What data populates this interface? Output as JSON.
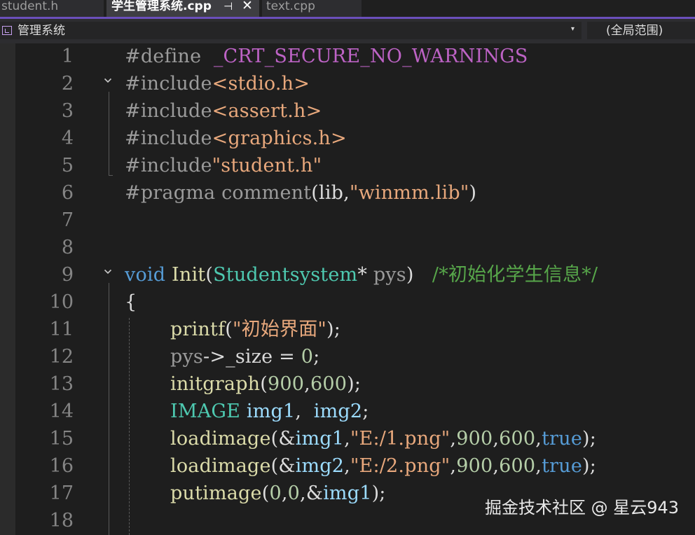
{
  "tabs": [
    {
      "label": "student.h",
      "active": false
    },
    {
      "label": "学生管理系统.cpp",
      "active": true
    },
    {
      "label": "text.cpp",
      "active": false
    }
  ],
  "tab_controls": {
    "pin": "⊣",
    "close": "✕"
  },
  "navigation": {
    "scope_label": "管理系统",
    "dropdown_arrow": "▾",
    "global_scope": "(全局范围)"
  },
  "code_lines": [
    {
      "n": "1",
      "fold": "",
      "parts": [
        {
          "t": "#define  ",
          "c": "#9b9b9b"
        },
        {
          "t": "_CRT_SECURE_NO_WARNINGS",
          "c": "#bd63c5"
        }
      ]
    },
    {
      "n": "2",
      "fold": "v",
      "parts": [
        {
          "t": "#include",
          "c": "#9b9b9b"
        },
        {
          "t": "<stdio.h>",
          "c": "#e8a87c"
        }
      ]
    },
    {
      "n": "3",
      "fold": "",
      "parts": [
        {
          "t": "#include",
          "c": "#9b9b9b"
        },
        {
          "t": "<assert.h>",
          "c": "#e8a87c"
        }
      ]
    },
    {
      "n": "4",
      "fold": "",
      "parts": [
        {
          "t": "#include",
          "c": "#9b9b9b"
        },
        {
          "t": "<graphics.h>",
          "c": "#e8a87c"
        }
      ]
    },
    {
      "n": "5",
      "fold": "",
      "parts": [
        {
          "t": "#include",
          "c": "#9b9b9b"
        },
        {
          "t": "\"student.h\"",
          "c": "#e8a87c"
        }
      ]
    },
    {
      "n": "6",
      "fold": "",
      "parts": [
        {
          "t": "#pragma comment",
          "c": "#9b9b9b"
        },
        {
          "t": "(lib,",
          "c": "#dcdcdc"
        },
        {
          "t": "\"winmm.lib\"",
          "c": "#e8a87c"
        },
        {
          "t": ")",
          "c": "#dcdcdc"
        }
      ]
    },
    {
      "n": "7",
      "fold": "",
      "parts": []
    },
    {
      "n": "8",
      "fold": "",
      "parts": []
    },
    {
      "n": "9",
      "fold": "v",
      "parts": [
        {
          "t": "void ",
          "c": "#569cd6"
        },
        {
          "t": "Init",
          "c": "#dcdcaa"
        },
        {
          "t": "(",
          "c": "#dcdcdc"
        },
        {
          "t": "Studentsystem",
          "c": "#4ec9b0"
        },
        {
          "t": "* ",
          "c": "#dcdcdc"
        },
        {
          "t": "pys",
          "c": "#9a9a9a"
        },
        {
          "t": ")   ",
          "c": "#dcdcdc"
        },
        {
          "t": "/*初始化学生信息*/",
          "c": "#57a64a"
        }
      ]
    },
    {
      "n": "10",
      "fold": "",
      "parts": [
        {
          "t": "{",
          "c": "#dcdcdc"
        }
      ]
    },
    {
      "n": "11",
      "fold": "",
      "indent": true,
      "parts": [
        {
          "t": "printf",
          "c": "#dcdcaa"
        },
        {
          "t": "(",
          "c": "#dcdcdc"
        },
        {
          "t": "\"初始界面\"",
          "c": "#e8a87c"
        },
        {
          "t": ");",
          "c": "#dcdcdc"
        }
      ]
    },
    {
      "n": "12",
      "fold": "",
      "indent": true,
      "parts": [
        {
          "t": "pys",
          "c": "#9a9a9a"
        },
        {
          "t": "->",
          "c": "#dcdcdc"
        },
        {
          "t": "_size",
          "c": "#dadada"
        },
        {
          "t": " = ",
          "c": "#dcdcdc"
        },
        {
          "t": "0",
          "c": "#b5cea8"
        },
        {
          "t": ";",
          "c": "#dcdcdc"
        }
      ]
    },
    {
      "n": "13",
      "fold": "",
      "indent": true,
      "parts": [
        {
          "t": "initgraph",
          "c": "#dcdcaa"
        },
        {
          "t": "(",
          "c": "#dcdcdc"
        },
        {
          "t": "900",
          "c": "#b5cea8"
        },
        {
          "t": ",",
          "c": "#dcdcdc"
        },
        {
          "t": "600",
          "c": "#b5cea8"
        },
        {
          "t": ");",
          "c": "#dcdcdc"
        }
      ]
    },
    {
      "n": "14",
      "fold": "",
      "indent": true,
      "parts": [
        {
          "t": "IMAGE ",
          "c": "#4ec9b0"
        },
        {
          "t": "img1",
          "c": "#9cdcfe"
        },
        {
          "t": ",  ",
          "c": "#dcdcdc"
        },
        {
          "t": "img2",
          "c": "#9cdcfe"
        },
        {
          "t": ";",
          "c": "#dcdcdc"
        }
      ]
    },
    {
      "n": "15",
      "fold": "",
      "indent": true,
      "parts": [
        {
          "t": "loadimage",
          "c": "#dcdcaa"
        },
        {
          "t": "(&",
          "c": "#dcdcdc"
        },
        {
          "t": "img1",
          "c": "#9cdcfe"
        },
        {
          "t": ",",
          "c": "#dcdcdc"
        },
        {
          "t": "\"E:/1.png\"",
          "c": "#e8a87c"
        },
        {
          "t": ",",
          "c": "#dcdcdc"
        },
        {
          "t": "900",
          "c": "#b5cea8"
        },
        {
          "t": ",",
          "c": "#dcdcdc"
        },
        {
          "t": "600",
          "c": "#b5cea8"
        },
        {
          "t": ",",
          "c": "#dcdcdc"
        },
        {
          "t": "true",
          "c": "#569cd6"
        },
        {
          "t": ");",
          "c": "#dcdcdc"
        }
      ]
    },
    {
      "n": "16",
      "fold": "",
      "indent": true,
      "parts": [
        {
          "t": "loadimage",
          "c": "#dcdcaa"
        },
        {
          "t": "(&",
          "c": "#dcdcdc"
        },
        {
          "t": "img2",
          "c": "#9cdcfe"
        },
        {
          "t": ",",
          "c": "#dcdcdc"
        },
        {
          "t": "\"E:/2.png\"",
          "c": "#e8a87c"
        },
        {
          "t": ",",
          "c": "#dcdcdc"
        },
        {
          "t": "900",
          "c": "#b5cea8"
        },
        {
          "t": ",",
          "c": "#dcdcdc"
        },
        {
          "t": "600",
          "c": "#b5cea8"
        },
        {
          "t": ",",
          "c": "#dcdcdc"
        },
        {
          "t": "true",
          "c": "#569cd6"
        },
        {
          "t": ");",
          "c": "#dcdcdc"
        }
      ]
    },
    {
      "n": "17",
      "fold": "",
      "indent": true,
      "parts": [
        {
          "t": "putimage",
          "c": "#dcdcaa"
        },
        {
          "t": "(",
          "c": "#dcdcdc"
        },
        {
          "t": "0",
          "c": "#b5cea8"
        },
        {
          "t": ",",
          "c": "#dcdcdc"
        },
        {
          "t": "0",
          "c": "#b5cea8"
        },
        {
          "t": ",&",
          "c": "#dcdcdc"
        },
        {
          "t": "img1",
          "c": "#9cdcfe"
        },
        {
          "t": ");",
          "c": "#dcdcdc"
        }
      ]
    },
    {
      "n": "18",
      "fold": "",
      "parts": []
    }
  ],
  "watermark": "掘金技术社区 @ 星云943",
  "colors": {
    "background": "#1e1e1e",
    "tab_accent": "#6b4fbb",
    "line_number": "#858585"
  }
}
